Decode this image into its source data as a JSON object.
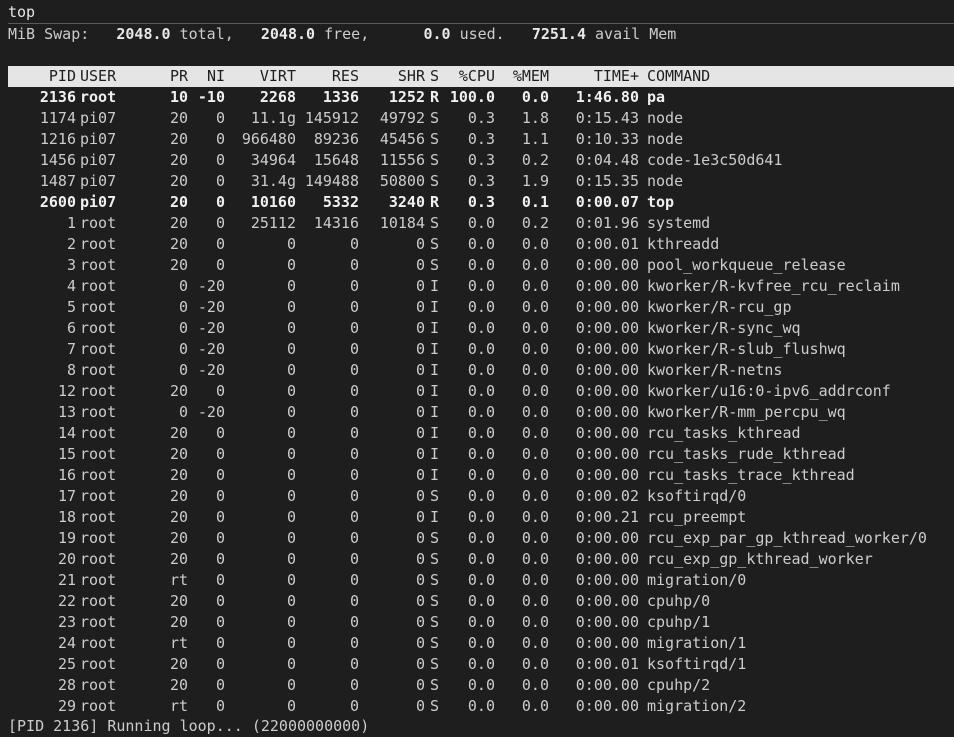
{
  "window": {
    "title": "top"
  },
  "swap": {
    "prefix": "MiB Swap:",
    "total": "2048.0",
    "total_label": "total,",
    "free": "2048.0",
    "free_label": "free,",
    "used": "0.0",
    "used_label": "used.",
    "avail": "7251.4",
    "avail_label": "avail Mem"
  },
  "columns": {
    "pid": "PID",
    "user": "USER",
    "pr": "PR",
    "ni": "NI",
    "virt": "VIRT",
    "res": "RES",
    "shr": "SHR",
    "s": "S",
    "cpu": "%CPU",
    "mem": "%MEM",
    "time": "TIME+",
    "command": "COMMAND"
  },
  "processes": [
    {
      "pid": "2136",
      "user": "root",
      "pr": "10",
      "ni": "-10",
      "virt": "2268",
      "res": "1336",
      "shr": "1252",
      "s": "R",
      "cpu": "100.0",
      "mem": "0.0",
      "time": "1:46.80",
      "command": "pa",
      "bold": true
    },
    {
      "pid": "1174",
      "user": "pi07",
      "pr": "20",
      "ni": "0",
      "virt": "11.1g",
      "res": "145912",
      "shr": "49792",
      "s": "S",
      "cpu": "0.3",
      "mem": "1.8",
      "time": "0:15.43",
      "command": "node"
    },
    {
      "pid": "1216",
      "user": "pi07",
      "pr": "20",
      "ni": "0",
      "virt": "966480",
      "res": "89236",
      "shr": "45456",
      "s": "S",
      "cpu": "0.3",
      "mem": "1.1",
      "time": "0:10.33",
      "command": "node"
    },
    {
      "pid": "1456",
      "user": "pi07",
      "pr": "20",
      "ni": "0",
      "virt": "34964",
      "res": "15648",
      "shr": "11556",
      "s": "S",
      "cpu": "0.3",
      "mem": "0.2",
      "time": "0:04.48",
      "command": "code-1e3c50d641"
    },
    {
      "pid": "1487",
      "user": "pi07",
      "pr": "20",
      "ni": "0",
      "virt": "31.4g",
      "res": "149488",
      "shr": "50800",
      "s": "S",
      "cpu": "0.3",
      "mem": "1.9",
      "time": "0:15.35",
      "command": "node"
    },
    {
      "pid": "2600",
      "user": "pi07",
      "pr": "20",
      "ni": "0",
      "virt": "10160",
      "res": "5332",
      "shr": "3240",
      "s": "R",
      "cpu": "0.3",
      "mem": "0.1",
      "time": "0:00.07",
      "command": "top",
      "bold": true
    },
    {
      "pid": "1",
      "user": "root",
      "pr": "20",
      "ni": "0",
      "virt": "25112",
      "res": "14316",
      "shr": "10184",
      "s": "S",
      "cpu": "0.0",
      "mem": "0.2",
      "time": "0:01.96",
      "command": "systemd"
    },
    {
      "pid": "2",
      "user": "root",
      "pr": "20",
      "ni": "0",
      "virt": "0",
      "res": "0",
      "shr": "0",
      "s": "S",
      "cpu": "0.0",
      "mem": "0.0",
      "time": "0:00.01",
      "command": "kthreadd"
    },
    {
      "pid": "3",
      "user": "root",
      "pr": "20",
      "ni": "0",
      "virt": "0",
      "res": "0",
      "shr": "0",
      "s": "S",
      "cpu": "0.0",
      "mem": "0.0",
      "time": "0:00.00",
      "command": "pool_workqueue_release"
    },
    {
      "pid": "4",
      "user": "root",
      "pr": "0",
      "ni": "-20",
      "virt": "0",
      "res": "0",
      "shr": "0",
      "s": "I",
      "cpu": "0.0",
      "mem": "0.0",
      "time": "0:00.00",
      "command": "kworker/R-kvfree_rcu_reclaim"
    },
    {
      "pid": "5",
      "user": "root",
      "pr": "0",
      "ni": "-20",
      "virt": "0",
      "res": "0",
      "shr": "0",
      "s": "I",
      "cpu": "0.0",
      "mem": "0.0",
      "time": "0:00.00",
      "command": "kworker/R-rcu_gp"
    },
    {
      "pid": "6",
      "user": "root",
      "pr": "0",
      "ni": "-20",
      "virt": "0",
      "res": "0",
      "shr": "0",
      "s": "I",
      "cpu": "0.0",
      "mem": "0.0",
      "time": "0:00.00",
      "command": "kworker/R-sync_wq"
    },
    {
      "pid": "7",
      "user": "root",
      "pr": "0",
      "ni": "-20",
      "virt": "0",
      "res": "0",
      "shr": "0",
      "s": "I",
      "cpu": "0.0",
      "mem": "0.0",
      "time": "0:00.00",
      "command": "kworker/R-slub_flushwq"
    },
    {
      "pid": "8",
      "user": "root",
      "pr": "0",
      "ni": "-20",
      "virt": "0",
      "res": "0",
      "shr": "0",
      "s": "I",
      "cpu": "0.0",
      "mem": "0.0",
      "time": "0:00.00",
      "command": "kworker/R-netns"
    },
    {
      "pid": "12",
      "user": "root",
      "pr": "20",
      "ni": "0",
      "virt": "0",
      "res": "0",
      "shr": "0",
      "s": "I",
      "cpu": "0.0",
      "mem": "0.0",
      "time": "0:00.00",
      "command": "kworker/u16:0-ipv6_addrconf"
    },
    {
      "pid": "13",
      "user": "root",
      "pr": "0",
      "ni": "-20",
      "virt": "0",
      "res": "0",
      "shr": "0",
      "s": "I",
      "cpu": "0.0",
      "mem": "0.0",
      "time": "0:00.00",
      "command": "kworker/R-mm_percpu_wq"
    },
    {
      "pid": "14",
      "user": "root",
      "pr": "20",
      "ni": "0",
      "virt": "0",
      "res": "0",
      "shr": "0",
      "s": "I",
      "cpu": "0.0",
      "mem": "0.0",
      "time": "0:00.00",
      "command": "rcu_tasks_kthread"
    },
    {
      "pid": "15",
      "user": "root",
      "pr": "20",
      "ni": "0",
      "virt": "0",
      "res": "0",
      "shr": "0",
      "s": "I",
      "cpu": "0.0",
      "mem": "0.0",
      "time": "0:00.00",
      "command": "rcu_tasks_rude_kthread"
    },
    {
      "pid": "16",
      "user": "root",
      "pr": "20",
      "ni": "0",
      "virt": "0",
      "res": "0",
      "shr": "0",
      "s": "I",
      "cpu": "0.0",
      "mem": "0.0",
      "time": "0:00.00",
      "command": "rcu_tasks_trace_kthread"
    },
    {
      "pid": "17",
      "user": "root",
      "pr": "20",
      "ni": "0",
      "virt": "0",
      "res": "0",
      "shr": "0",
      "s": "S",
      "cpu": "0.0",
      "mem": "0.0",
      "time": "0:00.02",
      "command": "ksoftirqd/0"
    },
    {
      "pid": "18",
      "user": "root",
      "pr": "20",
      "ni": "0",
      "virt": "0",
      "res": "0",
      "shr": "0",
      "s": "I",
      "cpu": "0.0",
      "mem": "0.0",
      "time": "0:00.21",
      "command": "rcu_preempt"
    },
    {
      "pid": "19",
      "user": "root",
      "pr": "20",
      "ni": "0",
      "virt": "0",
      "res": "0",
      "shr": "0",
      "s": "S",
      "cpu": "0.0",
      "mem": "0.0",
      "time": "0:00.00",
      "command": "rcu_exp_par_gp_kthread_worker/0"
    },
    {
      "pid": "20",
      "user": "root",
      "pr": "20",
      "ni": "0",
      "virt": "0",
      "res": "0",
      "shr": "0",
      "s": "S",
      "cpu": "0.0",
      "mem": "0.0",
      "time": "0:00.00",
      "command": "rcu_exp_gp_kthread_worker"
    },
    {
      "pid": "21",
      "user": "root",
      "pr": "rt",
      "ni": "0",
      "virt": "0",
      "res": "0",
      "shr": "0",
      "s": "S",
      "cpu": "0.0",
      "mem": "0.0",
      "time": "0:00.00",
      "command": "migration/0"
    },
    {
      "pid": "22",
      "user": "root",
      "pr": "20",
      "ni": "0",
      "virt": "0",
      "res": "0",
      "shr": "0",
      "s": "S",
      "cpu": "0.0",
      "mem": "0.0",
      "time": "0:00.00",
      "command": "cpuhp/0"
    },
    {
      "pid": "23",
      "user": "root",
      "pr": "20",
      "ni": "0",
      "virt": "0",
      "res": "0",
      "shr": "0",
      "s": "S",
      "cpu": "0.0",
      "mem": "0.0",
      "time": "0:00.00",
      "command": "cpuhp/1"
    },
    {
      "pid": "24",
      "user": "root",
      "pr": "rt",
      "ni": "0",
      "virt": "0",
      "res": "0",
      "shr": "0",
      "s": "S",
      "cpu": "0.0",
      "mem": "0.0",
      "time": "0:00.00",
      "command": "migration/1"
    },
    {
      "pid": "25",
      "user": "root",
      "pr": "20",
      "ni": "0",
      "virt": "0",
      "res": "0",
      "shr": "0",
      "s": "S",
      "cpu": "0.0",
      "mem": "0.0",
      "time": "0:00.01",
      "command": "ksoftirqd/1"
    },
    {
      "pid": "28",
      "user": "root",
      "pr": "20",
      "ni": "0",
      "virt": "0",
      "res": "0",
      "shr": "0",
      "s": "S",
      "cpu": "0.0",
      "mem": "0.0",
      "time": "0:00.00",
      "command": "cpuhp/2"
    },
    {
      "pid": "29",
      "user": "root",
      "pr": "rt",
      "ni": "0",
      "virt": "0",
      "res": "0",
      "shr": "0",
      "s": "S",
      "cpu": "0.0",
      "mem": "0.0",
      "time": "0:00.00",
      "command": "migration/2"
    }
  ],
  "status_line": "[PID 2136] Running loop... (22000000000)",
  "colors": {
    "background": "#1e1e1e",
    "text": "#cccccc",
    "header_bar": "#e5e5e5",
    "header_text": "#1e1e1e"
  }
}
